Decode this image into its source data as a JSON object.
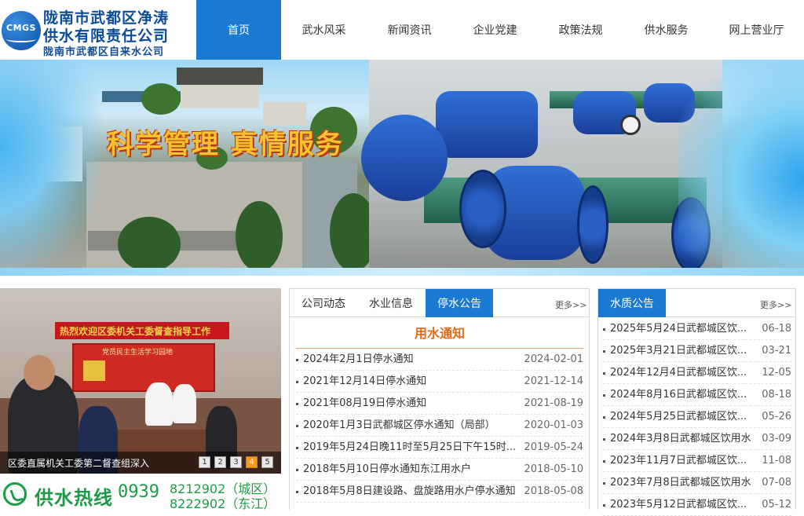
{
  "header": {
    "logo_text": "CMGS",
    "company_name_line1": "陇南市武都区净涛",
    "company_name_line2": "供水有限责任公司",
    "company_name_line3": "陇南市武都区自来水公司"
  },
  "nav": {
    "items": [
      "首页",
      "武水风采",
      "新闻资讯",
      "企业党建",
      "政策法规",
      "供水服务",
      "网上营业厅"
    ],
    "active_index": 0
  },
  "banner": {
    "slogan": "科学管理 真情服务"
  },
  "photo": {
    "banner_text": "热烈欢迎区委机关工委督查指导工作",
    "board_text": "党员民主生活学习园地",
    "caption": "区委直属机关工委第二督查组深入",
    "pages": [
      "1",
      "2",
      "3",
      "4",
      "5"
    ],
    "active_page": "4"
  },
  "hotline": {
    "label": "供水热线",
    "area_code": "0939",
    "number1": "8212902（城区）",
    "number2": "8222902（东江）"
  },
  "middle_panel": {
    "tabs": [
      "公司动态",
      "水业信息",
      "停水公告"
    ],
    "active_tab": "停水公告",
    "more": "更多>>",
    "section_title": "用水通知",
    "items": [
      {
        "title": "2024年2月1日停水通知",
        "date": "2024-02-01"
      },
      {
        "title": "2021年12月14日停水通知",
        "date": "2021-12-14"
      },
      {
        "title": "2021年08月19日停水通知",
        "date": "2021-08-19"
      },
      {
        "title": "2020年1月3日武都城区停水通知（局部）",
        "date": "2020-01-03"
      },
      {
        "title": "2019年5月24日晚11时至5月25日下午15时...",
        "date": "2019-05-24"
      },
      {
        "title": "2018年5月10日停水通知东江用水户",
        "date": "2018-05-10"
      },
      {
        "title": "2018年5月8日建设路、盘旋路用水户停水通知",
        "date": "2018-05-08"
      }
    ]
  },
  "right_panel": {
    "tab": "水质公告",
    "more": "更多>>",
    "items": [
      {
        "title": "2025年5月24日武都城区饮...",
        "date": "06-18"
      },
      {
        "title": "2025年3月21日武都城区饮...",
        "date": "03-21"
      },
      {
        "title": "2024年12月4日武都城区饮...",
        "date": "12-05"
      },
      {
        "title": "2024年8月16日武都城区饮...",
        "date": "08-18"
      },
      {
        "title": "2024年5月25日武都城区饮...",
        "date": "05-26"
      },
      {
        "title": "2024年3月8日武都城区饮用水",
        "date": "03-09"
      },
      {
        "title": "2023年11月7日武都城区饮...",
        "date": "11-08"
      },
      {
        "title": "2023年7月8日武都城区饮用水",
        "date": "07-08"
      },
      {
        "title": "2023年5月12日武都城区饮...",
        "date": "05-12"
      }
    ]
  },
  "colors": {
    "accent": "#1a7ad2",
    "brand": "#0a4a9a",
    "highlight": "#e36b17",
    "hotline": "#1b9c44"
  }
}
